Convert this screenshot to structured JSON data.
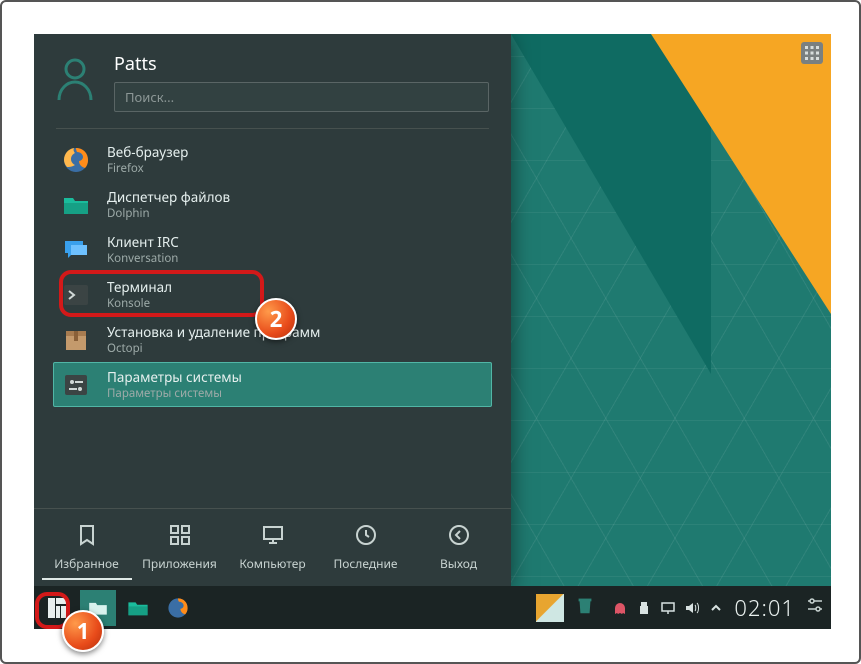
{
  "user": {
    "name": "Patts"
  },
  "search": {
    "placeholder": "Поиск..."
  },
  "apps": [
    {
      "title": "Веб-браузер",
      "sub": "Firefox",
      "icon": "firefox"
    },
    {
      "title": "Диспетчер файлов",
      "sub": "Dolphin",
      "icon": "folder"
    },
    {
      "title": "Клиент IRC",
      "sub": "Konversation",
      "icon": "chat"
    },
    {
      "title": "Терминал",
      "sub": "Konsole",
      "icon": "terminal"
    },
    {
      "title": "Установка и удаление программ",
      "sub": "Octopi",
      "icon": "package"
    },
    {
      "title": "Параметры системы",
      "sub": "Параметры системы",
      "icon": "settings"
    }
  ],
  "bottom_tabs": [
    {
      "label": "Избранное",
      "icon": "bookmark",
      "active": true
    },
    {
      "label": "Приложения",
      "icon": "grid",
      "active": false
    },
    {
      "label": "Компьютер",
      "icon": "monitor",
      "active": false
    },
    {
      "label": "Последние",
      "icon": "clock",
      "active": false
    },
    {
      "label": "Выход",
      "icon": "back",
      "active": false
    }
  ],
  "taskbar": {
    "items": [
      "launcher",
      "running",
      "files",
      "firefox"
    ]
  },
  "tray": {
    "trash": "trash",
    "ghost": "ghost"
  },
  "clock": "02:01",
  "annotations": {
    "badge1": "1",
    "badge2": "2"
  },
  "colors": {
    "accent": "#2c8074",
    "menu_bg": "#2e3b3c",
    "highlight_red": "#d31919",
    "badge_orange": "#e84b1a"
  }
}
